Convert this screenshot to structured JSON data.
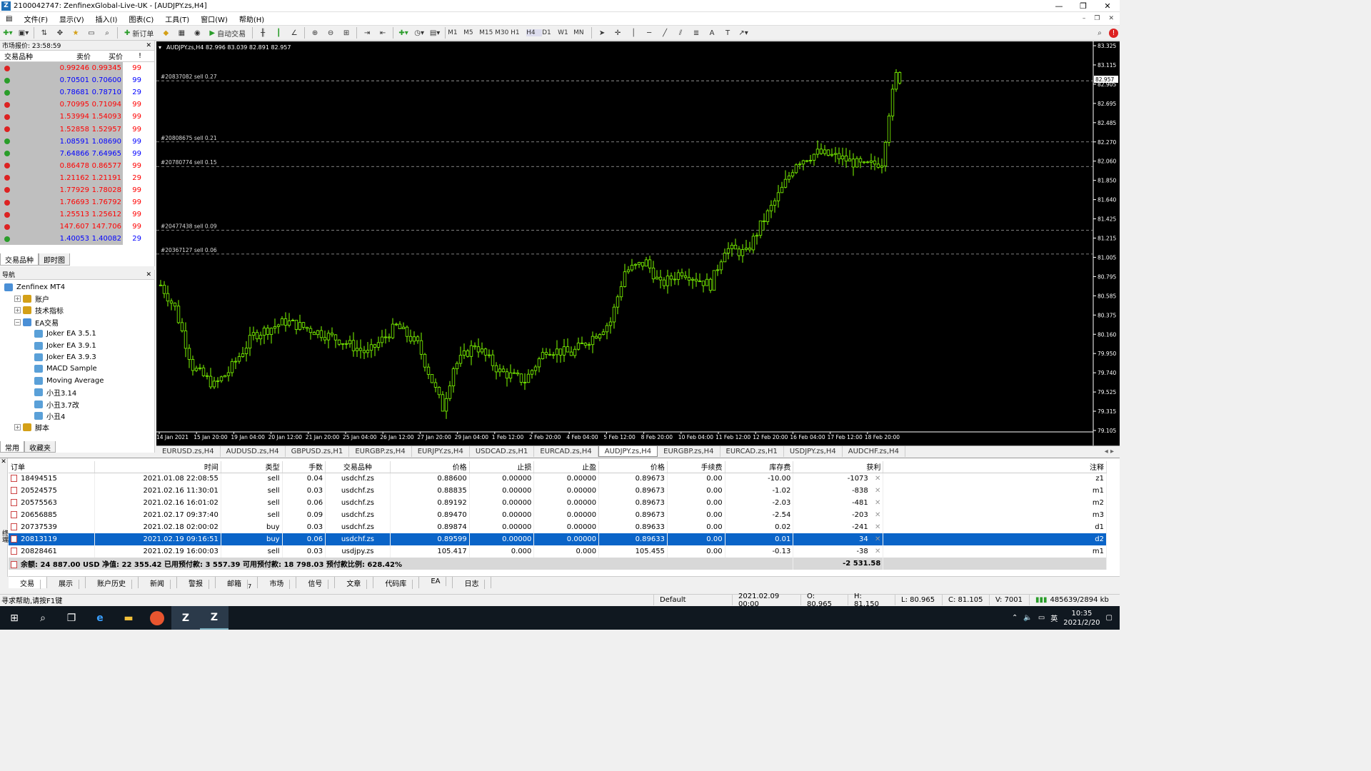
{
  "window": {
    "title": "2100042747: ZenfinexGlobal-Live-UK - [AUDJPY.zs,H4]",
    "app_letter": "Z"
  },
  "menu": [
    "文件(F)",
    "显示(V)",
    "插入(I)",
    "图表(C)",
    "工具(T)",
    "窗口(W)",
    "帮助(H)"
  ],
  "toolbar": {
    "new_order": "新订单",
    "auto_trading": "自动交易",
    "timeframes": [
      "M1",
      "M5",
      "M15",
      "M30",
      "H1",
      "H4",
      "D1",
      "W1",
      "MN"
    ]
  },
  "market_watch": {
    "header": "市场报价: 23:58:59",
    "columns": [
      "交易品种",
      "卖价",
      "买价",
      "!"
    ],
    "rows": [
      {
        "bid": "0.99246",
        "ask": "0.99345",
        "spread": "99",
        "dir": "down"
      },
      {
        "bid": "0.70501",
        "ask": "0.70600",
        "spread": "99",
        "dir": "up"
      },
      {
        "bid": "0.78681",
        "ask": "0.78710",
        "spread": "29",
        "dir": "up"
      },
      {
        "bid": "0.70995",
        "ask": "0.71094",
        "spread": "99",
        "dir": "down"
      },
      {
        "bid": "1.53994",
        "ask": "1.54093",
        "spread": "99",
        "dir": "down"
      },
      {
        "bid": "1.52858",
        "ask": "1.52957",
        "spread": "99",
        "dir": "down"
      },
      {
        "bid": "1.08591",
        "ask": "1.08690",
        "spread": "99",
        "dir": "up"
      },
      {
        "bid": "7.64866",
        "ask": "7.64965",
        "spread": "99",
        "dir": "up"
      },
      {
        "bid": "0.86478",
        "ask": "0.86577",
        "spread": "99",
        "dir": "down"
      },
      {
        "bid": "1.21162",
        "ask": "1.21191",
        "spread": "29",
        "dir": "down"
      },
      {
        "bid": "1.77929",
        "ask": "1.78028",
        "spread": "99",
        "dir": "down"
      },
      {
        "bid": "1.76693",
        "ask": "1.76792",
        "spread": "99",
        "dir": "down"
      },
      {
        "bid": "1.25513",
        "ask": "1.25612",
        "spread": "99",
        "dir": "down"
      },
      {
        "bid": "147.607",
        "ask": "147.706",
        "spread": "99",
        "dir": "down"
      },
      {
        "bid": "1.40053",
        "ask": "1.40082",
        "spread": "29",
        "dir": "up"
      }
    ],
    "tabs": [
      "交易品种",
      "即时图"
    ]
  },
  "navigator": {
    "header": "导航",
    "items": [
      {
        "label": "Zenfinex MT4",
        "level": 0,
        "exp": ""
      },
      {
        "label": "账户",
        "level": 1,
        "exp": "+"
      },
      {
        "label": "技术指标",
        "level": 1,
        "exp": "+"
      },
      {
        "label": "EA交易",
        "level": 1,
        "exp": "−"
      },
      {
        "label": "Joker EA 3.5.1",
        "level": 2,
        "exp": ""
      },
      {
        "label": "Joker EA 3.9.1",
        "level": 2,
        "exp": ""
      },
      {
        "label": "Joker EA 3.9.3",
        "level": 2,
        "exp": ""
      },
      {
        "label": "MACD Sample",
        "level": 2,
        "exp": ""
      },
      {
        "label": "Moving Average",
        "level": 2,
        "exp": ""
      },
      {
        "label": "小丑3.14",
        "level": 2,
        "exp": ""
      },
      {
        "label": "小丑3.7改",
        "level": 2,
        "exp": ""
      },
      {
        "label": "小丑4",
        "level": 2,
        "exp": ""
      },
      {
        "label": "脚本",
        "level": 1,
        "exp": "+"
      }
    ],
    "tabs": [
      "常用",
      "收藏夹"
    ]
  },
  "chart": {
    "header": "AUDJPY.zs,H4  82.996 83.039 82.891 82.957",
    "current_price": "82.957",
    "price_levels": [
      "83.325",
      "83.115",
      "82.905",
      "82.695",
      "82.485",
      "82.270",
      "82.060",
      "81.850",
      "81.640",
      "81.425",
      "81.215",
      "81.005",
      "80.795",
      "80.585",
      "80.375",
      "80.160",
      "79.950",
      "79.740",
      "79.525",
      "79.315",
      "79.105"
    ],
    "time_labels": [
      "14 Jan 2021",
      "15 Jan 20:00",
      "19 Jan 04:00",
      "20 Jan 12:00",
      "21 Jan 20:00",
      "25 Jan 04:00",
      "26 Jan 12:00",
      "27 Jan 20:00",
      "29 Jan 04:00",
      "1 Feb 12:00",
      "2 Feb 20:00",
      "4 Feb 04:00",
      "5 Feb 12:00",
      "8 Feb 20:00",
      "10 Feb 04:00",
      "11 Feb 12:00",
      "12 Feb 20:00",
      "16 Feb 04:00",
      "17 Feb 12:00",
      "18 Feb 20:00"
    ],
    "order_lines": [
      {
        "label": "#20837082 sell 0.27",
        "price": 82.94
      },
      {
        "label": "#20808675 sell 0.21",
        "price": 82.27
      },
      {
        "label": "#20780774 sell 0.15",
        "price": 82.0
      },
      {
        "label": "#20477438 sell 0.09",
        "price": 81.3
      },
      {
        "label": "#20367127 sell 0.06",
        "price": 81.04
      }
    ]
  },
  "chart_tabs": [
    "EURUSD.zs,H4",
    "AUDUSD.zs,H4",
    "GBPUSD.zs,H1",
    "EURGBP.zs,H4",
    "EURJPY.zs,H4",
    "USDCAD.zs,H1",
    "EURCAD.zs,H4",
    "AUDJPY.zs,H4",
    "EURGBP.zs,H4",
    "EURCAD.zs,H1",
    "USDJPY.zs,H4",
    "AUDCHF.zs,H4"
  ],
  "terminal": {
    "columns": [
      "订单",
      "时间",
      "类型",
      "手数",
      "交易品种",
      "价格",
      "止损",
      "止盈",
      "价格",
      "手续费",
      "库存费",
      "获利",
      "注释"
    ],
    "rows": [
      [
        "18494515",
        "2021.01.08 22:08:55",
        "sell",
        "0.04",
        "usdchf.zs",
        "0.88600",
        "0.00000",
        "0.00000",
        "0.89673",
        "0.00",
        "-10.00",
        "-1073",
        "z1"
      ],
      [
        "20524575",
        "2021.02.16 11:30:01",
        "sell",
        "0.03",
        "usdchf.zs",
        "0.88835",
        "0.00000",
        "0.00000",
        "0.89673",
        "0.00",
        "-1.02",
        "-838",
        "m1"
      ],
      [
        "20575563",
        "2021.02.16 16:01:02",
        "sell",
        "0.06",
        "usdchf.zs",
        "0.89192",
        "0.00000",
        "0.00000",
        "0.89673",
        "0.00",
        "-2.03",
        "-481",
        "m2"
      ],
      [
        "20656885",
        "2021.02.17 09:37:40",
        "sell",
        "0.09",
        "usdchf.zs",
        "0.89470",
        "0.00000",
        "0.00000",
        "0.89673",
        "0.00",
        "-2.54",
        "-203",
        "m3"
      ],
      [
        "20737539",
        "2021.02.18 02:00:02",
        "buy",
        "0.03",
        "usdchf.zs",
        "0.89874",
        "0.00000",
        "0.00000",
        "0.89633",
        "0.00",
        "0.02",
        "-241",
        "d1"
      ],
      [
        "20813119",
        "2021.02.19 09:16:51",
        "buy",
        "0.06",
        "usdchf.zs",
        "0.89599",
        "0.00000",
        "0.00000",
        "0.89633",
        "0.00",
        "0.01",
        "34",
        "d2"
      ],
      [
        "20828461",
        "2021.02.19 16:00:03",
        "sell",
        "0.03",
        "usdjpy.zs",
        "105.417",
        "0.000",
        "0.000",
        "105.455",
        "0.00",
        "-0.13",
        "-38",
        "m1"
      ]
    ],
    "selected_row": 5,
    "balance_text": "余额: 24 887.00 USD  净值: 22 355.42  已用预付款: 3 557.39  可用预付款: 18 798.03  预付款比例: 628.42%",
    "balance_profit": "-2 531.58",
    "side_label": "终端",
    "tabs": [
      "交易",
      "展示",
      "账户历史",
      "新闻",
      "警报",
      "邮箱",
      "市场",
      "信号",
      "文章",
      "代码库",
      "EA",
      "日志"
    ],
    "mail_count": "7"
  },
  "statusbar": {
    "help": "寻求帮助,请按F1键",
    "profile": "Default",
    "time": "2021.02.09 00:00",
    "open": "O: 80.965",
    "high": "H: 81.150",
    "low": "L: 80.965",
    "close": "C: 81.105",
    "volume": "V: 7001",
    "traffic": "485639/2894 kb"
  },
  "taskbar": {
    "time": "10:35",
    "date": "2021/2/20",
    "ime": "英"
  },
  "colors": {
    "bull": "#7fff00",
    "chart_bg": "#000000",
    "bid_color": "#ff0000",
    "ask_color": "#0000ff",
    "selected": "#0a64c8"
  }
}
